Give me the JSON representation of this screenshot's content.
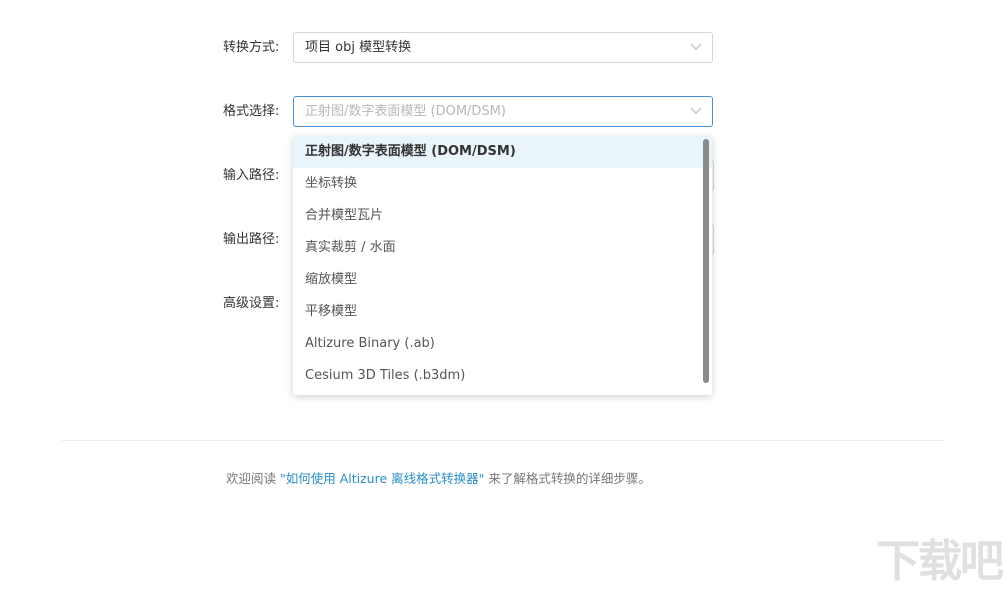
{
  "form": {
    "conversion_mode": {
      "label": "转换方式:",
      "value": "项目 obj 模型转换"
    },
    "format_select": {
      "label": "格式选择:",
      "placeholder": "正射图/数字表面模型 (DOM/DSM)"
    },
    "input_path": {
      "label": "输入路径:"
    },
    "output_path": {
      "label": "输出路径:"
    },
    "advanced": {
      "label": "高级设置:"
    }
  },
  "dropdown": {
    "options": [
      "正射图/数字表面模型 (DOM/DSM)",
      "坐标转换",
      "合并模型瓦片",
      "真实裁剪 / 水面",
      "缩放模型",
      "平移模型",
      "Altizure Binary (.ab)",
      "Cesium 3D Tiles (.b3dm)"
    ],
    "selected_index": 0
  },
  "footer": {
    "prefix": "欢迎阅读 ",
    "link": "\"如何使用 Altizure 离线格式转换器\"",
    "suffix": " 来了解格式转换的详细步骤。"
  },
  "watermark": "下载吧",
  "colors": {
    "accent": "#4a90d9",
    "link": "#2a8fc5",
    "selected_bg": "#e9f4fb"
  }
}
